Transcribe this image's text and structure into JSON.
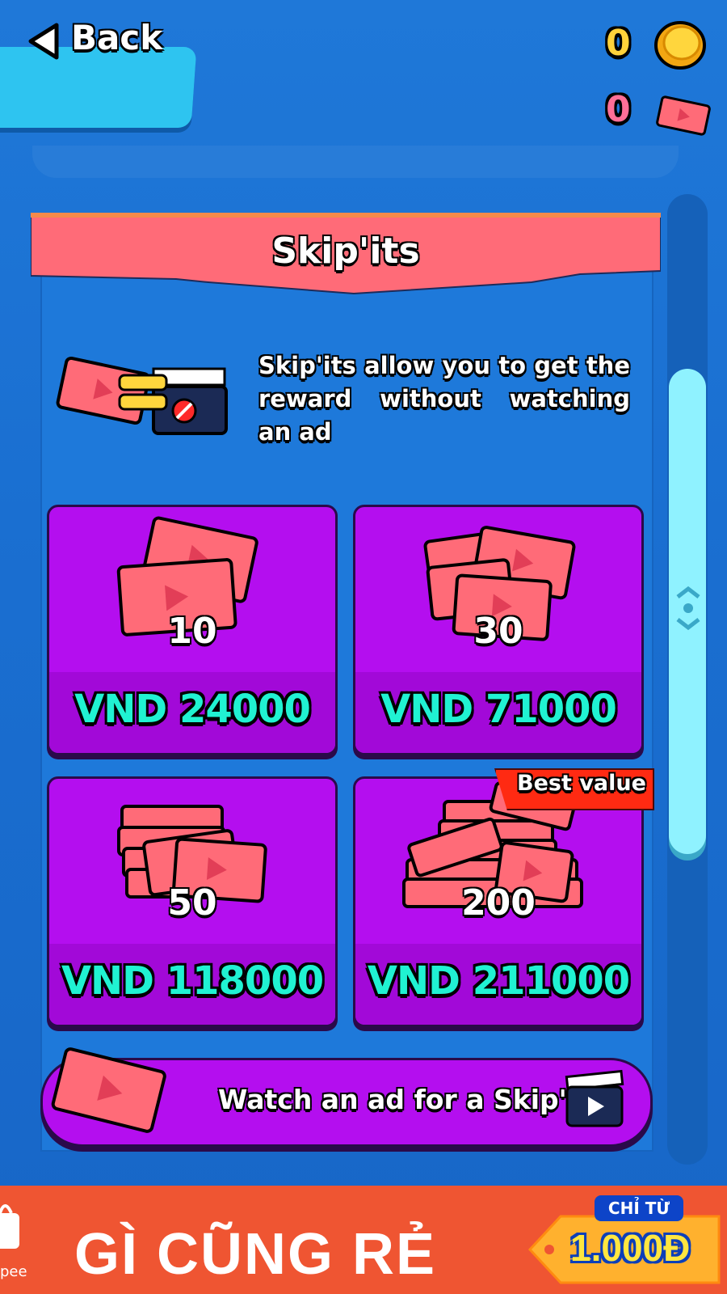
{
  "header": {
    "back_label": "Back",
    "coins": "0",
    "skipits": "0"
  },
  "panel": {
    "title": "Skip'its",
    "description": "Skip'its allow you to get the reward without watching an ad"
  },
  "packs": [
    {
      "count": "10",
      "price": "VND 24000"
    },
    {
      "count": "30",
      "price": "VND 71000"
    },
    {
      "count": "50",
      "price": "VND 118000"
    },
    {
      "count": "200",
      "price": "VND 211000",
      "badge": "Best value"
    }
  ],
  "watch_ad": {
    "label": "Watch an ad for a Skip'it"
  },
  "ad": {
    "headline": "GÌ CŨNG RẺ",
    "tag_top": "CHỈ TỪ",
    "tag_price": "1.000Đ",
    "logo_text": "pee"
  },
  "colors": {
    "background": "#1f78d8",
    "card": "#b40eef",
    "price_text": "#20f2d2",
    "title_banner": "#ff6b78",
    "badge": "#ff2a12",
    "ad_banner": "#ef5532"
  },
  "icons": {
    "back": "triangle-left-icon",
    "coin": "coin-icon",
    "skipit": "ticket-icon",
    "clapper": "clapperboard-icon"
  }
}
